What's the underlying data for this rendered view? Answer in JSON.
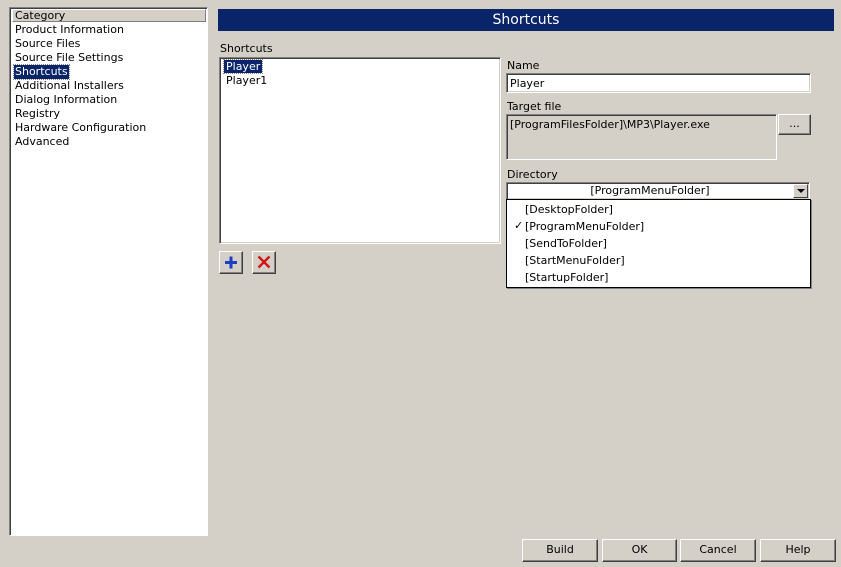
{
  "category": {
    "header": "Category",
    "items": [
      {
        "label": "Product Information"
      },
      {
        "label": "Source Files"
      },
      {
        "label": "Source File Settings"
      },
      {
        "label": "Shortcuts",
        "selected": true
      },
      {
        "label": "Additional Installers"
      },
      {
        "label": "Dialog Information"
      },
      {
        "label": "Registry"
      },
      {
        "label": "Hardware Configuration"
      },
      {
        "label": "Advanced"
      }
    ]
  },
  "title": "Shortcuts",
  "shortcuts": {
    "label": "Shortcuts",
    "items": [
      {
        "label": "Player",
        "selected": true
      },
      {
        "label": "Player1"
      }
    ],
    "add_icon": "plus-icon",
    "remove_icon": "delete-x-icon"
  },
  "name": {
    "label": "Name",
    "value": "Player"
  },
  "target": {
    "label": "Target file",
    "value": "[ProgramFilesFolder]\\MP3\\Player.exe",
    "browse_label": "..."
  },
  "directory": {
    "label": "Directory",
    "value": "[ProgramMenuFolder]",
    "options": [
      {
        "label": "[DesktopFolder]"
      },
      {
        "label": "[ProgramMenuFolder]",
        "checked": true
      },
      {
        "label": "[SendToFolder]"
      },
      {
        "label": "[StartMenuFolder]"
      },
      {
        "label": "[StartupFolder]"
      }
    ],
    "check_glyph": "✓"
  },
  "footer": {
    "build": "Build",
    "ok": "OK",
    "cancel": "Cancel",
    "help": "Help"
  },
  "colors": {
    "title_bar": "#0a246a",
    "background": "#d4d0c8",
    "add_icon": "#1a3fc2",
    "remove_icon": "#d01818"
  }
}
